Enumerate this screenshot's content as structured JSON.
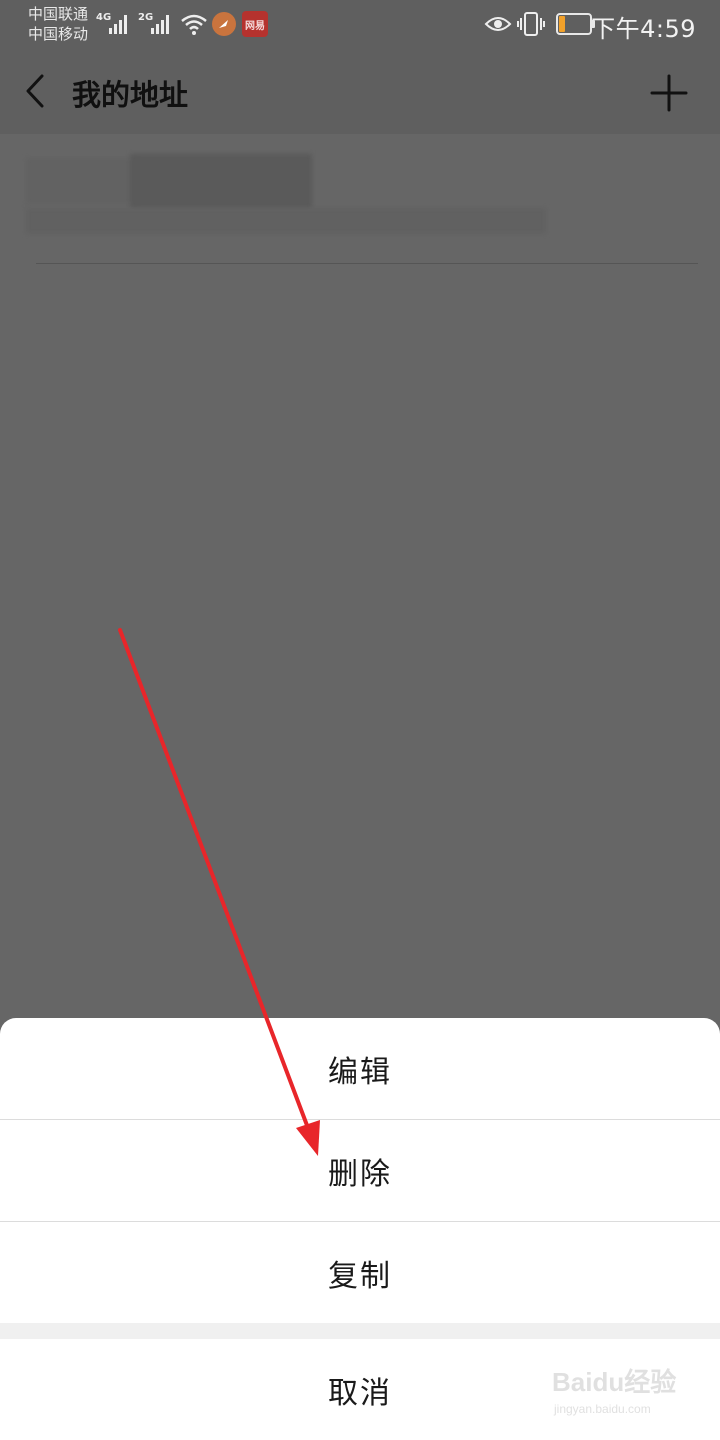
{
  "status_bar": {
    "carrier_1": "中国联通",
    "carrier_2": "中国移动",
    "network_1": "4G",
    "network_2": "2G",
    "app_badge_2": "网易",
    "time": "下午4:59",
    "battery_level": 0.2,
    "icons": [
      "signal-icon",
      "wifi-icon",
      "app-notification-icon",
      "eye-icon",
      "vibrate-icon",
      "battery-icon"
    ]
  },
  "header": {
    "back_icon": "chevron-left-icon",
    "title": "我的地址",
    "add_icon": "plus-icon"
  },
  "action_sheet": {
    "items": [
      {
        "label": "编辑"
      },
      {
        "label": "删除"
      },
      {
        "label": "复制"
      }
    ],
    "cancel_label": "取消"
  },
  "watermark": {
    "brand": "Baidu经验",
    "url": "jingyan.baidu.com"
  },
  "colors": {
    "overlay": "#666666",
    "sheet_bg": "#ffffff",
    "annotation_arrow": "#e8262a",
    "battery_fill": "#f2a12a"
  }
}
